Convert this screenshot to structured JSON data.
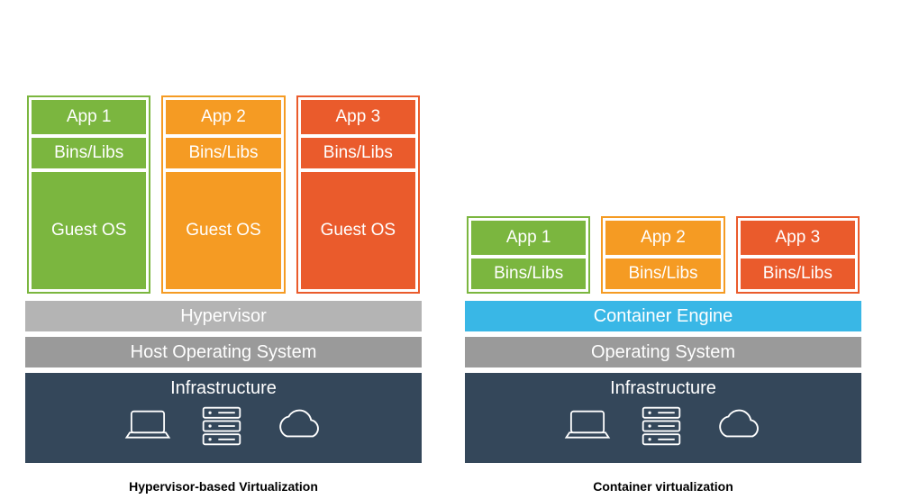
{
  "hypervisor_side": {
    "caption": "Hypervisor-based Virtualization",
    "stacks": [
      {
        "theme": "green",
        "app": "App 1",
        "bins": "Bins/Libs",
        "guest": "Guest OS"
      },
      {
        "theme": "orange",
        "app": "App 2",
        "bins": "Bins/Libs",
        "guest": "Guest OS"
      },
      {
        "theme": "red",
        "app": "App 3",
        "bins": "Bins/Libs",
        "guest": "Guest OS"
      }
    ],
    "layers": {
      "hypervisor": "Hypervisor",
      "host_os": "Host Operating System",
      "infra": "Infrastructure"
    },
    "infra_icons": [
      "laptop-icon",
      "server-icon",
      "cloud-icon"
    ]
  },
  "container_side": {
    "caption": "Container virtualization",
    "stacks": [
      {
        "theme": "green",
        "app": "App 1",
        "bins": "Bins/Libs"
      },
      {
        "theme": "orange",
        "app": "App 2",
        "bins": "Bins/Libs"
      },
      {
        "theme": "red",
        "app": "App 3",
        "bins": "Bins/Libs"
      }
    ],
    "layers": {
      "engine": "Container Engine",
      "os": "Operating System",
      "infra": "Infrastructure"
    },
    "infra_icons": [
      "laptop-icon",
      "server-icon",
      "cloud-icon"
    ]
  },
  "colors": {
    "green": "#7bb63f",
    "orange": "#f59b23",
    "red": "#ea5b2c",
    "layer_light": "#b4b4b4",
    "layer_med": "#9a9a9a",
    "layer_blue": "#39b7e6",
    "infra_bg": "#34475a"
  }
}
